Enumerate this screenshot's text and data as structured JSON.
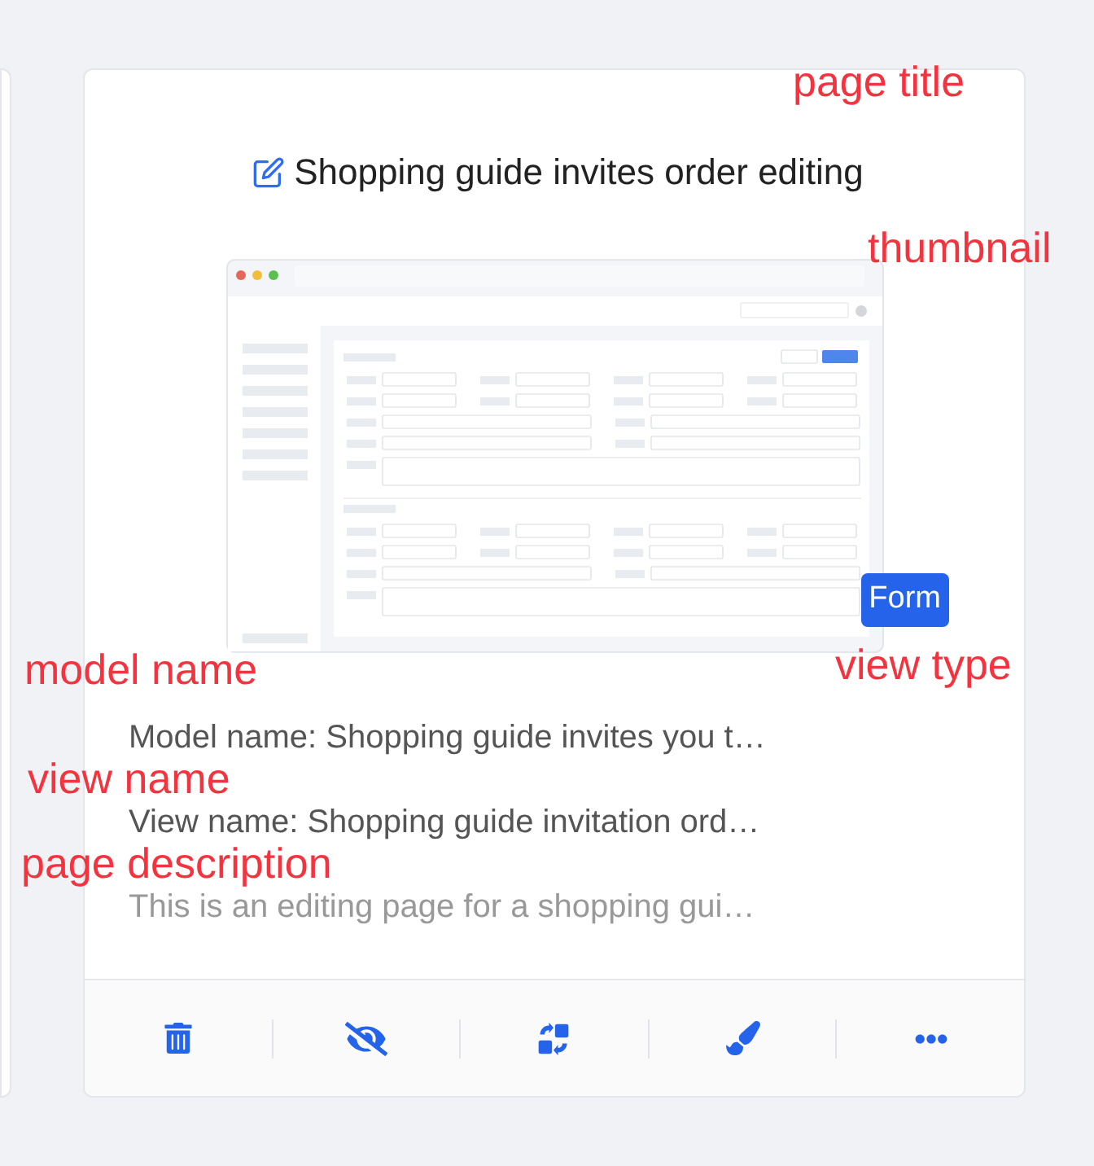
{
  "card": {
    "title": "Shopping guide invites order editing",
    "view_type": "Form",
    "model_name": "Model name: Shopping guide invites you t…",
    "view_name": "View name: Shopping guide invitation ord…",
    "description": "This is an editing page for a shopping gui…",
    "actions": [
      {
        "kind": "delete"
      },
      {
        "kind": "hide"
      },
      {
        "kind": "switch"
      },
      {
        "kind": "style"
      },
      {
        "kind": "more"
      }
    ]
  },
  "annotations": [
    {
      "kind": "title",
      "text": "page title"
    },
    {
      "kind": "thumbnail",
      "text": "thumbnail"
    },
    {
      "kind": "model",
      "text": "model name"
    },
    {
      "kind": "viewtype",
      "text": "view type"
    },
    {
      "kind": "viewname",
      "text": "view name"
    },
    {
      "kind": "description",
      "text": "page description"
    }
  ]
}
